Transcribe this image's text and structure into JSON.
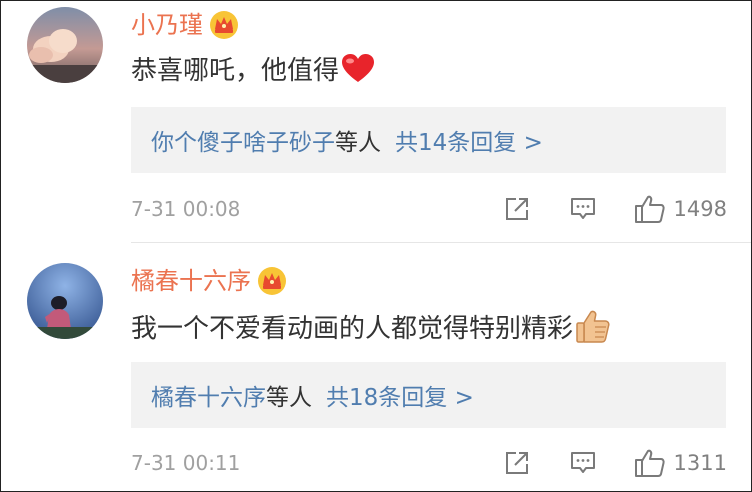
{
  "comments": [
    {
      "username": "小乃瑾",
      "text": "恭喜哪吒，他值得",
      "emoji": "red-heart",
      "replies": {
        "users": "你个傻子啥子砂子",
        "middle": "等人",
        "count": "共14条回复 >"
      },
      "time": "7-31 00:08",
      "likes": "1498"
    },
    {
      "username": "橘春十六序",
      "text": "我一个不爱看动画的人都觉得特别精彩",
      "emoji": "thumbs-up",
      "replies": {
        "users": "橘春十六序",
        "middle": "等人",
        "count": "共18条回复 >"
      },
      "time": "7-31 00:11",
      "likes": "1311"
    }
  ],
  "colors": {
    "username": "#eb7350",
    "link": "#507daf",
    "text": "#333333",
    "meta": "#a0a0a0",
    "reply_bg": "#f2f2f2"
  }
}
